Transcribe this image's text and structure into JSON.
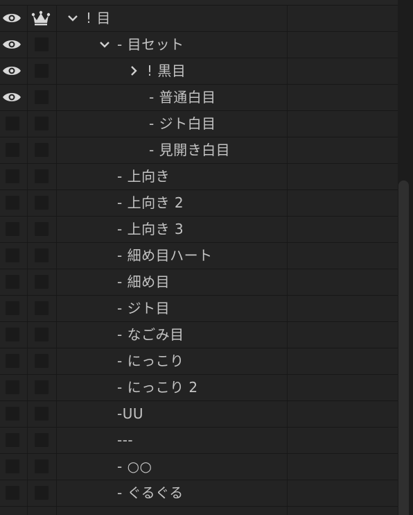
{
  "layers": [
    {
      "label": "! 目",
      "visible": true,
      "icon": "crown-icon",
      "arrow": "chevron-down-icon"
    },
    {
      "label": "- 目セット",
      "visible": true,
      "arrow": "chevron-down-icon"
    },
    {
      "label": "! 黒目",
      "visible": true,
      "arrow": "chevron-right-icon"
    },
    {
      "label": "- 普通白目",
      "visible": true
    },
    {
      "label": "- ジト白目",
      "visible": false
    },
    {
      "label": "- 見開き白目",
      "visible": false
    },
    {
      "label": "- 上向き",
      "visible": false
    },
    {
      "label": "- 上向き 2",
      "visible": false
    },
    {
      "label": "- 上向き 3",
      "visible": false
    },
    {
      "label": "- 細め目ハート",
      "visible": false
    },
    {
      "label": "- 細め目",
      "visible": false
    },
    {
      "label": "- ジト目",
      "visible": false
    },
    {
      "label": "- なごみ目",
      "visible": false
    },
    {
      "label": "- にっこり",
      "visible": false
    },
    {
      "label": "- にっこり 2",
      "visible": false
    },
    {
      "label": "-UU",
      "visible": false
    },
    {
      "label": "---",
      "visible": false
    },
    {
      "label": "- ○○",
      "visible": false
    },
    {
      "label": "- ぐるぐる",
      "visible": false
    }
  ],
  "colors": {
    "background": "#202020",
    "text": "#c4c4c4",
    "icon": "#d8d8d8"
  }
}
